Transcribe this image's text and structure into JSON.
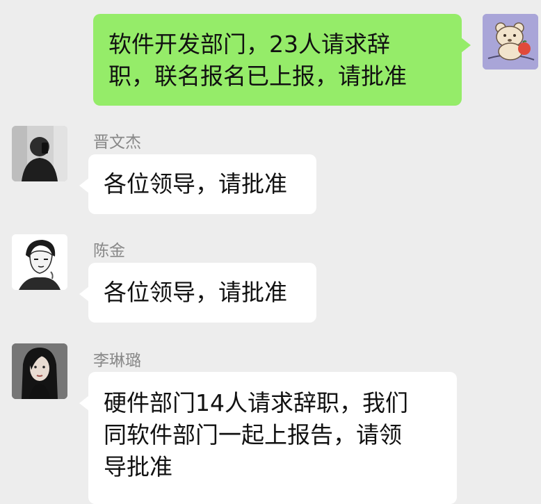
{
  "chat": {
    "colors": {
      "background": "#ededed",
      "outgoing_bubble": "#95ec69",
      "incoming_bubble": "#ffffff",
      "name_text": "#888888"
    },
    "messages": [
      {
        "direction": "outgoing",
        "text": "软件开发部门，23人请求辞\n职，联名报名已上报，请批准",
        "avatar_icon": "bear-avatar-icon"
      },
      {
        "direction": "incoming",
        "sender": "晋文杰",
        "text": "各位领导，请批准",
        "avatar_icon": "mirror-selfie-avatar-icon"
      },
      {
        "direction": "incoming",
        "sender": "陈金",
        "text": "各位领导，请批准",
        "avatar_icon": "sketch-portrait-avatar-icon"
      },
      {
        "direction": "incoming",
        "sender": "李琳璐",
        "text": "硬件部门14人请求辞职，我们\n同软件部门一起上报告，请领\n导批准",
        "avatar_icon": "woman-portrait-avatar-icon"
      }
    ]
  }
}
